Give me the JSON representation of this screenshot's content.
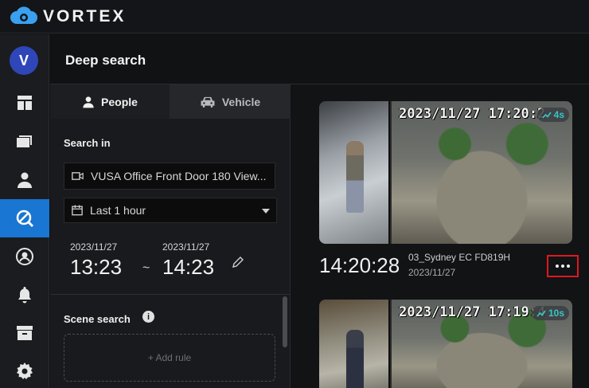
{
  "app": {
    "brand": "VORTEX"
  },
  "user": {
    "initial": "V"
  },
  "nav": [
    {
      "icon": "dashboard-icon"
    },
    {
      "icon": "cameras-icon"
    },
    {
      "icon": "person-icon"
    },
    {
      "icon": "deep-search-icon",
      "active": true
    },
    {
      "icon": "account-icon"
    },
    {
      "icon": "bell-icon"
    },
    {
      "icon": "archive-icon"
    },
    {
      "icon": "gear-icon"
    }
  ],
  "page": {
    "title": "Deep search"
  },
  "tabs": {
    "people": "People",
    "vehicle": "Vehicle"
  },
  "search_in": {
    "label": "Search in",
    "camera": "VUSA Office Front Door 180 View...",
    "range": "Last 1 hour"
  },
  "time_range": {
    "start_date": "2023/11/27",
    "start_time": "13:23",
    "separator": "~",
    "end_date": "2023/11/27",
    "end_time": "14:23"
  },
  "scene_search": {
    "label": "Scene search",
    "add_rule": "+ Add rule"
  },
  "results": [
    {
      "overlay_timestamp": "2023/11/27 17:20:2",
      "duration": "4s",
      "time": "14:20:28",
      "camera": "03_Sydney EC FD819H",
      "date": "2023/11/27"
    },
    {
      "overlay_timestamp": "2023/11/27 17:19:4",
      "duration": "10s"
    }
  ],
  "colors": {
    "accent": "#1976d2",
    "highlight": "#e0181f",
    "badge": "#35c6c6"
  }
}
